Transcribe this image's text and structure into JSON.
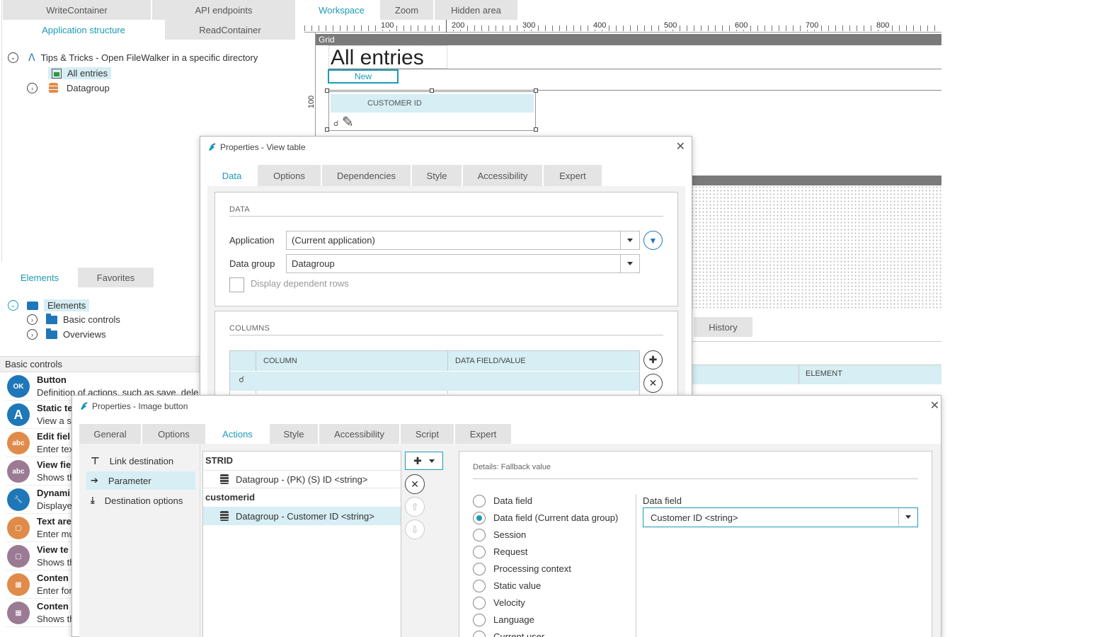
{
  "structure_panel": {
    "tabs_row1": [
      "WriteContainer",
      "API endpoints"
    ],
    "tabs_row2": [
      "Application structure",
      "ReadContainer"
    ],
    "tree": {
      "root": "Tips & Tricks - Open FileWalker in a specific directory",
      "child_selected": "All entries",
      "child2": "Datagroup"
    }
  },
  "elements_panel": {
    "tabs": [
      "Elements",
      "Favorites"
    ],
    "tree_root": "Elements",
    "tree_items": [
      "Basic controls",
      "Overviews"
    ],
    "section_title": "Basic controls",
    "items": [
      {
        "title": "Button",
        "desc": "Definition of actions, such as save, dele",
        "icon": "ok-icon",
        "color": "#1e77b8"
      },
      {
        "title": "Static te",
        "desc": "View a st",
        "icon": "text-a-icon",
        "color": "#1e77b8"
      },
      {
        "title": "Edit fiel",
        "desc": "Enter tex",
        "icon": "abc-icon",
        "color": "#e08b4a"
      },
      {
        "title": "View fie",
        "desc": "Shows th",
        "icon": "abc-view-icon",
        "color": "#9b7a94"
      },
      {
        "title": "Dynami",
        "desc": "Displaye",
        "icon": "wrench-icon",
        "color": "#1e77b8"
      },
      {
        "title": "Text are",
        "desc": "Enter mu",
        "icon": "textarea-icon",
        "color": "#e08b4a"
      },
      {
        "title": "View te",
        "desc": "Shows th",
        "icon": "textarea-view-icon",
        "color": "#9b7a94"
      },
      {
        "title": "Conten",
        "desc": "Enter for",
        "icon": "content-icon",
        "color": "#e08b4a"
      },
      {
        "title": "Conten",
        "desc": "Shows th",
        "icon": "content-view-icon",
        "color": "#9b7a94"
      }
    ]
  },
  "workspace": {
    "tabs": [
      "Workspace",
      "Zoom",
      "Hidden area"
    ],
    "ruler_x": [
      "100",
      "200",
      "300",
      "400",
      "500",
      "600",
      "700",
      "800"
    ],
    "ruler_y": "100",
    "grid_label": "Grid",
    "page_title": "All entries",
    "new_button": "New",
    "table_header": "CUSTOMER ID",
    "history_tab": "History",
    "element_col": "ELEMENT"
  },
  "dialog_view_table": {
    "title": "Properties - View table",
    "tabs": [
      "Data",
      "Options",
      "Dependencies",
      "Style",
      "Accessibility",
      "Expert"
    ],
    "data_group_label": "DATA",
    "application_label": "Application",
    "application_value": "(Current application)",
    "datagroup_label": "Data group",
    "datagroup_value": "Datagroup",
    "dependent_rows_label": "Display dependent rows",
    "columns_group_label": "COLUMNS",
    "col_header_1": "COLUMN",
    "col_header_2": "DATA FIELD/VALUE"
  },
  "dialog_image_button": {
    "title": "Properties - Image button",
    "tabs": [
      "General",
      "Options",
      "Actions",
      "Style",
      "Accessibility",
      "Script",
      "Expert"
    ],
    "nav": [
      "Link destination",
      "Parameter",
      "Destination options"
    ],
    "param_groups": [
      {
        "name": "STRID",
        "value": "Datagroup - (PK) (S) ID <string>"
      },
      {
        "name": "customerid",
        "value": "Datagroup - Customer ID <string>"
      }
    ],
    "details_label": "Details: Fallback value",
    "radio_options": [
      "Data field",
      "Data field (Current data group)",
      "Session",
      "Request",
      "Processing context",
      "Static value",
      "Velocity",
      "Language",
      "Current user"
    ],
    "selected_radio": 1,
    "data_field_label": "Data field",
    "data_field_value": "Customer ID <string>"
  },
  "colors": {
    "accent": "#1a9bb5",
    "selection": "#d6eef4",
    "tab_bg": "#e4e4e4"
  }
}
